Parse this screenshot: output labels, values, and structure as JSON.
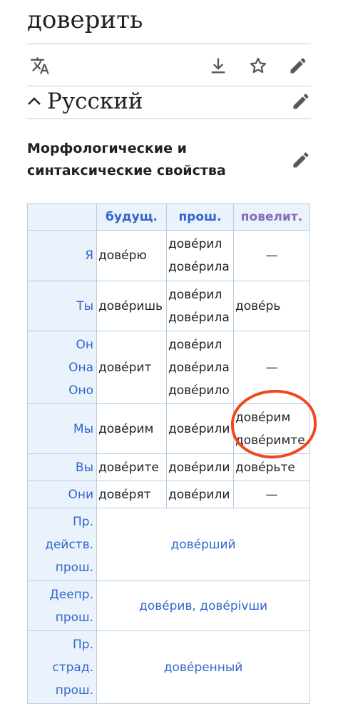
{
  "page": {
    "title": "доверить"
  },
  "toolbar": {
    "icons": [
      "translate-icon",
      "download-icon",
      "star-icon",
      "edit-icon"
    ]
  },
  "section": {
    "title": "Русский"
  },
  "subsection": {
    "title": "Морфологические и синтаксические свойства"
  },
  "conjugation": {
    "headers": [
      "",
      "будущ.",
      "прош.",
      "повелит."
    ],
    "rows": [
      {
        "pronouns": [
          "Я"
        ],
        "future": [
          "дове́рю"
        ],
        "past": [
          "дове́рил",
          "дове́рила"
        ],
        "imperative": [
          "—"
        ]
      },
      {
        "pronouns": [
          "Ты"
        ],
        "future": [
          "дове́ришь"
        ],
        "past": [
          "дове́рил",
          "дове́рила"
        ],
        "imperative": [
          "дове́рь"
        ]
      },
      {
        "pronouns": [
          "Он",
          "Она",
          "Оно"
        ],
        "future": [
          "дове́рит"
        ],
        "past": [
          "дове́рил",
          "дове́рила",
          "дове́рило"
        ],
        "imperative": [
          "—"
        ]
      },
      {
        "pronouns": [
          "Мы"
        ],
        "future": [
          "дове́рим"
        ],
        "past": [
          "дове́рили"
        ],
        "imperative": [
          "дове́рим",
          "дове́римте"
        ]
      },
      {
        "pronouns": [
          "Вы"
        ],
        "future": [
          "дове́рите"
        ],
        "past": [
          "дове́рили"
        ],
        "imperative": [
          "дове́рьте"
        ]
      },
      {
        "pronouns": [
          "Они"
        ],
        "future": [
          "дове́рят"
        ],
        "past": [
          "дове́рили"
        ],
        "imperative": [
          "—"
        ]
      }
    ],
    "participles": [
      {
        "label": [
          "Пр.",
          "действ.",
          "прош."
        ],
        "value": "дове́рший"
      },
      {
        "label": [
          "Деепр.",
          "прош."
        ],
        "value": "дове́рив, дове́рivши"
      },
      {
        "label": [
          "Пр.",
          "страд.",
          "прош."
        ],
        "value": "дове́ренный"
      }
    ]
  },
  "colors": {
    "link": "#3366cc",
    "header_bg": "#eaf3fb",
    "imperative_header": "#8a6bb8",
    "annotation": "#f0471f"
  }
}
